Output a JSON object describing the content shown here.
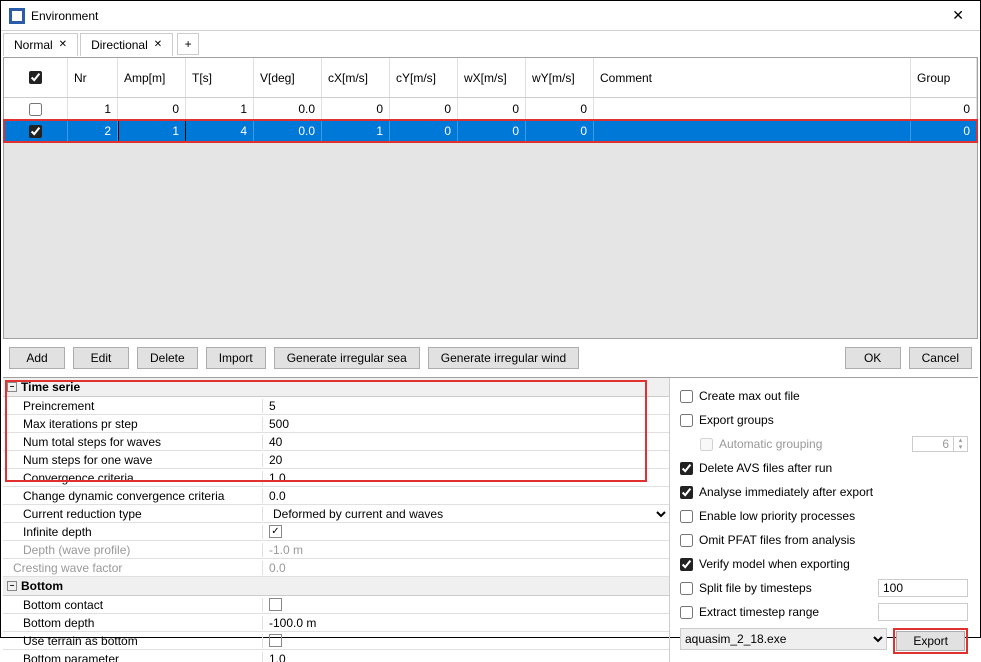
{
  "window": {
    "title": "Environment"
  },
  "tabs": [
    {
      "label": "Normal",
      "active": true
    },
    {
      "label": "Directional",
      "active": false
    }
  ],
  "grid": {
    "headers": {
      "nr": "Nr",
      "amp": "Amp[m]",
      "ts": "T[s]",
      "vdeg": "V[deg]",
      "cx": "cX[m/s]",
      "cy": "cY[m/s]",
      "wx": "wX[m/s]",
      "wy": "wY[m/s]",
      "comment": "Comment",
      "group": "Group"
    },
    "rows": [
      {
        "checked": false,
        "nr": "1",
        "amp": "0",
        "ts": "1",
        "vdeg": "0.0",
        "cx": "0",
        "cy": "0",
        "wx": "0",
        "wy": "0",
        "comment": "",
        "group": "0",
        "selected": false
      },
      {
        "checked": true,
        "nr": "2",
        "amp": "1",
        "ts": "4",
        "vdeg": "0.0",
        "cx": "1",
        "cy": "0",
        "wx": "0",
        "wy": "0",
        "comment": "",
        "group": "0",
        "selected": true
      }
    ]
  },
  "buttons": {
    "add": "Add",
    "edit": "Edit",
    "delete": "Delete",
    "import": "Import",
    "gen_sea": "Generate irregular sea",
    "gen_wind": "Generate irregular wind",
    "ok": "OK",
    "cancel": "Cancel"
  },
  "props": {
    "time_serie": {
      "header": "Time serie",
      "preincrement": {
        "label": "Preincrement",
        "value": "5"
      },
      "max_iter": {
        "label": "Max iterations pr step",
        "value": "500"
      },
      "num_total_waves": {
        "label": "Num total steps for waves",
        "value": "40"
      },
      "num_one_wave": {
        "label": "Num steps for one wave",
        "value": "20"
      },
      "convergence": {
        "label": "Convergence criteria",
        "value": "1.0"
      },
      "change_dyn": {
        "label": "Change dynamic convergence criteria",
        "value": "0.0"
      },
      "reduction_type": {
        "label": "Current reduction type",
        "value": "Deformed by current and waves"
      },
      "infinite_depth": {
        "label": "Infinite depth",
        "checked": true
      },
      "depth_profile": {
        "label": "Depth (wave profile)",
        "value": "-1.0 m"
      },
      "cresting": {
        "label": "Cresting wave factor",
        "value": "0.0"
      }
    },
    "bottom": {
      "header": "Bottom",
      "contact": {
        "label": "Bottom contact",
        "checked": false
      },
      "depth": {
        "label": "Bottom depth",
        "value": "-100.0 m"
      },
      "terrain": {
        "label": "Use terrain as bottom",
        "checked": false
      },
      "parameter": {
        "label": "Bottom parameter",
        "value": "1.0"
      }
    }
  },
  "right": {
    "create_max": {
      "label": "Create max out file",
      "checked": false
    },
    "export_groups": {
      "label": "Export groups",
      "checked": false
    },
    "auto_grouping": {
      "label": "Automatic grouping",
      "value": "6"
    },
    "delete_avs": {
      "label": "Delete AVS files after run",
      "checked": true
    },
    "analyse_after": {
      "label": "Analyse immediately after export",
      "checked": true
    },
    "low_priority": {
      "label": "Enable low priority processes",
      "checked": false
    },
    "omit_pfat": {
      "label": "Omit PFAT files from analysis",
      "checked": false
    },
    "verify_model": {
      "label": "Verify model when exporting",
      "checked": true
    },
    "split_timesteps": {
      "label": "Split file by timesteps",
      "checked": false,
      "value": "100"
    },
    "extract_range": {
      "label": "Extract timestep range",
      "checked": false,
      "value": ""
    },
    "exe": "aquasim_2_18.exe",
    "export_btn": "Export"
  }
}
